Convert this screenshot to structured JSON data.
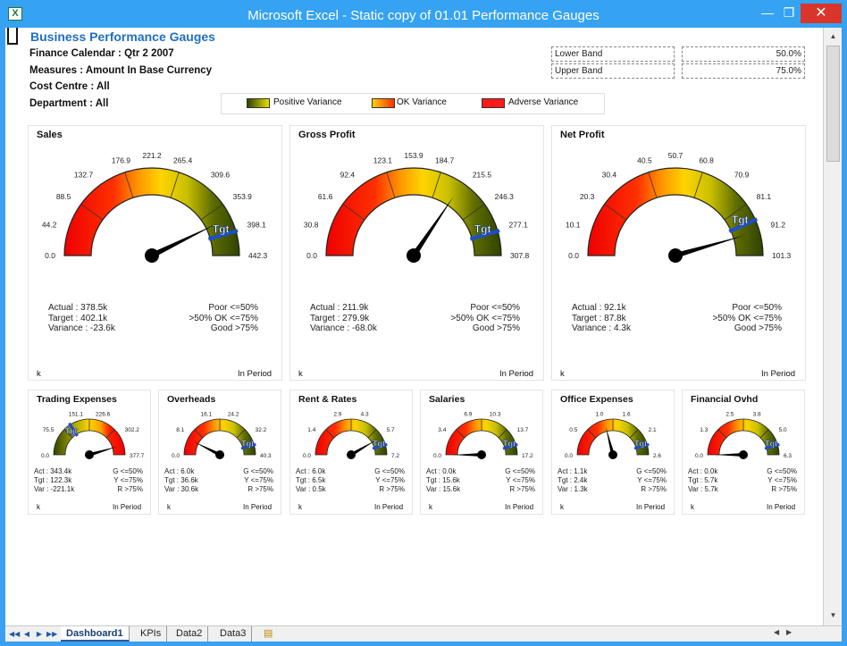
{
  "window": {
    "title": "Microsoft Excel - Static copy of 01.01 Performance Gauges",
    "app_icon": "excel-icon"
  },
  "header": {
    "title": "Business Performance Gauges",
    "meta": [
      "Finance Calendar : Qtr 2 2007",
      "Measures : Amount In Base Currency",
      "Cost Centre : All",
      "Department : All"
    ]
  },
  "bands": {
    "lower_label": "Lower Band",
    "lower_value": "50.0%",
    "upper_label": "Upper Band",
    "upper_value": "75.0%"
  },
  "legend": [
    {
      "label": "Positive Variance",
      "colors": [
        "#334400",
        "#f0e000"
      ]
    },
    {
      "label": "OK Variance",
      "colors": [
        "#ffd200",
        "#ff3000"
      ]
    },
    {
      "label": "Adverse Variance",
      "colors": [
        "#ff1a1a",
        "#ff1a1a"
      ]
    }
  ],
  "gauges_large": [
    {
      "title": "Sales",
      "ticks": [
        "0.0",
        "44.2",
        "88.5",
        "132.7",
        "176.9",
        "221.2",
        "265.4",
        "309.6",
        "353.9",
        "398.1",
        "442.3"
      ],
      "needle_fraction": 0.855,
      "target_fraction": 0.91,
      "stats_left": [
        "Actual : 378.5k",
        "Target : 402.1k",
        "Variance : -23.6k"
      ],
      "stats_right": [
        "Poor <=50%",
        ">50% OK <=75%",
        "Good >75%"
      ],
      "foot_left": "k",
      "foot_right": "In Period"
    },
    {
      "title": "Gross Profit",
      "ticks": [
        "0.0",
        "30.8",
        "61.6",
        "92.4",
        "123.1",
        "153.9",
        "184.7",
        "215.5",
        "246.3",
        "277.1",
        "307.8"
      ],
      "needle_fraction": 0.689,
      "target_fraction": 0.91,
      "stats_left": [
        "Actual : 211.9k",
        "Target : 279.9k",
        "Variance : -68.0k"
      ],
      "stats_right": [
        "Poor <=50%",
        ">50% OK <=75%",
        "Good >75%"
      ],
      "foot_left": "k",
      "foot_right": "In Period"
    },
    {
      "title": "Net Profit",
      "ticks": [
        "0.0",
        "10.1",
        "20.3",
        "30.4",
        "40.5",
        "50.7",
        "60.8",
        "70.9",
        "81.1",
        "91.2",
        "101.3"
      ],
      "needle_fraction": 0.91,
      "target_fraction": 0.866,
      "stats_left": [
        "Actual : 92.1k",
        "Target : 87.8k",
        "Variance : 4.3k"
      ],
      "stats_right": [
        "Poor <=50%",
        ">50% OK <=75%",
        "Good >75%"
      ],
      "foot_left": "k",
      "foot_right": "In Period"
    }
  ],
  "gauges_small": [
    {
      "title": "Trading Expenses",
      "ticks": [
        "0.0",
        "75.5",
        "151.1",
        "226.6",
        "302.2",
        "377.7"
      ],
      "reversed": true,
      "needle_fraction": 0.909,
      "target_fraction": 0.32,
      "stats_left": [
        "Act : 343.4k",
        "Tgt : 122.3k",
        "Var : -221.1k"
      ],
      "stats_right": [
        "G <=50%",
        "Y <=75%",
        "R >75%"
      ],
      "foot_left": "k",
      "foot_right": "In Period"
    },
    {
      "title": "Overheads",
      "ticks": [
        "0.0",
        "8.1",
        "16.1",
        "24.2",
        "32.2",
        "40.3"
      ],
      "reversed": false,
      "needle_fraction": 0.15,
      "target_fraction": 0.91,
      "stats_left": [
        "Act : 6.0k",
        "Tgt : 36.6k",
        "Var : 30.6k"
      ],
      "stats_right": [
        "G <=50%",
        "Y <=75%",
        "R >75%"
      ],
      "foot_left": "k",
      "foot_right": "In Period"
    },
    {
      "title": "Rent & Rates",
      "ticks": [
        "1.4",
        "2.9",
        "4.3",
        "5.7",
        "7.2"
      ],
      "reversed": false,
      "needle_fraction": 0.83,
      "target_fraction": 0.91,
      "stats_left": [
        "Act : 6.0k",
        "Tgt : 6.5k",
        "Var : 0.5k"
      ],
      "stats_right": [
        "G <=50%",
        "Y <=75%",
        "R >75%"
      ],
      "foot_left": "k",
      "foot_right": "In Period"
    },
    {
      "title": "Salaries",
      "ticks": [
        "3.4",
        "6.9",
        "10.3",
        "13.7",
        "17.2"
      ],
      "reversed": false,
      "needle_fraction": 0.0,
      "target_fraction": 0.91,
      "stats_left": [
        "Act : 0.0k",
        "Tgt : 15.6k",
        "Var : 15.6k"
      ],
      "stats_right": [
        "G <=50%",
        "Y <=75%",
        "R >75%"
      ],
      "foot_left": "k",
      "foot_right": "In Period"
    },
    {
      "title": "Office Expenses",
      "ticks": [
        "0.5",
        "1.0",
        "1.6",
        "2.1",
        "2.6"
      ],
      "reversed": false,
      "needle_fraction": 0.42,
      "target_fraction": 0.91,
      "stats_left": [
        "Act : 1.1k",
        "Tgt : 2.4k",
        "Var : 1.3k"
      ],
      "stats_right": [
        "G <=50%",
        "Y <=75%",
        "R >75%"
      ],
      "foot_left": "k",
      "foot_right": "In Period"
    },
    {
      "title": "Financial Ovhd",
      "ticks": [
        "1.3",
        "2.5",
        "3.8",
        "5.0",
        "6.3"
      ],
      "reversed": false,
      "needle_fraction": 0.0,
      "target_fraction": 0.91,
      "stats_left": [
        "Act : 0.0k",
        "Tgt : 5.7k",
        "Var : 5.7k"
      ],
      "stats_right": [
        "G <=50%",
        "Y <=75%",
        "R >75%"
      ],
      "foot_left": "k",
      "foot_right": "In Period"
    }
  ],
  "target_label": "Tgt",
  "sheet_tabs": [
    "Dashboard1",
    "KPIs",
    "Data2",
    "Data3"
  ],
  "active_tab": "Dashboard1"
}
